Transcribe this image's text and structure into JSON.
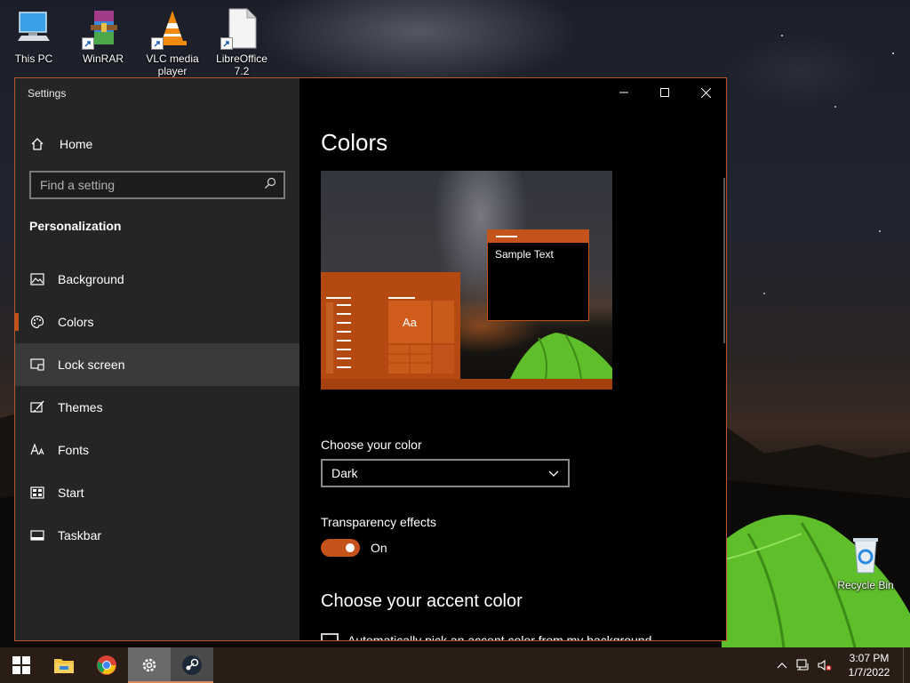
{
  "desktop": {
    "icons": [
      {
        "label": "This PC",
        "icon": "this-pc-icon"
      },
      {
        "label": "WinRAR",
        "icon": "winrar-icon"
      },
      {
        "label": "VLC media player",
        "icon": "vlc-icon"
      },
      {
        "label": "LibreOffice 7.2",
        "icon": "libreoffice-icon"
      },
      {
        "label": "Recycle Bin",
        "icon": "recycle-bin-icon"
      }
    ]
  },
  "window": {
    "title": "Settings",
    "controls": [
      "minimize",
      "maximize",
      "close"
    ]
  },
  "sidebar": {
    "home_label": "Home",
    "search_placeholder": "Find a setting",
    "section_title": "Personalization",
    "items": [
      {
        "label": "Background",
        "icon": "picture-icon"
      },
      {
        "label": "Colors",
        "icon": "palette-icon",
        "selected": true
      },
      {
        "label": "Lock screen",
        "icon": "lock-screen-icon",
        "hovered": true
      },
      {
        "label": "Themes",
        "icon": "brush-icon"
      },
      {
        "label": "Fonts",
        "icon": "font-icon"
      },
      {
        "label": "Start",
        "icon": "start-icon"
      },
      {
        "label": "Taskbar",
        "icon": "taskbar-icon"
      }
    ]
  },
  "main": {
    "title": "Colors",
    "preview": {
      "sample_text": "Sample Text",
      "tile_text": "Aa"
    },
    "choose_color_label": "Choose your color",
    "choose_color_value": "Dark",
    "transparency_label": "Transparency effects",
    "transparency_state": "On",
    "accent_heading": "Choose your accent color",
    "auto_accent_label": "Automatically pick an accent color from my background"
  },
  "taskbar": {
    "time": "3:07 PM",
    "date": "1/7/2022",
    "pinned": [
      "start-icon",
      "file-explorer-icon",
      "chrome-icon",
      "settings-icon",
      "steam-icon"
    ]
  },
  "colors": {
    "accent": "#c4521b",
    "sidebar_bg": "#262628",
    "content_bg": "#000000",
    "taskbar_bg": "#2a1d16"
  }
}
